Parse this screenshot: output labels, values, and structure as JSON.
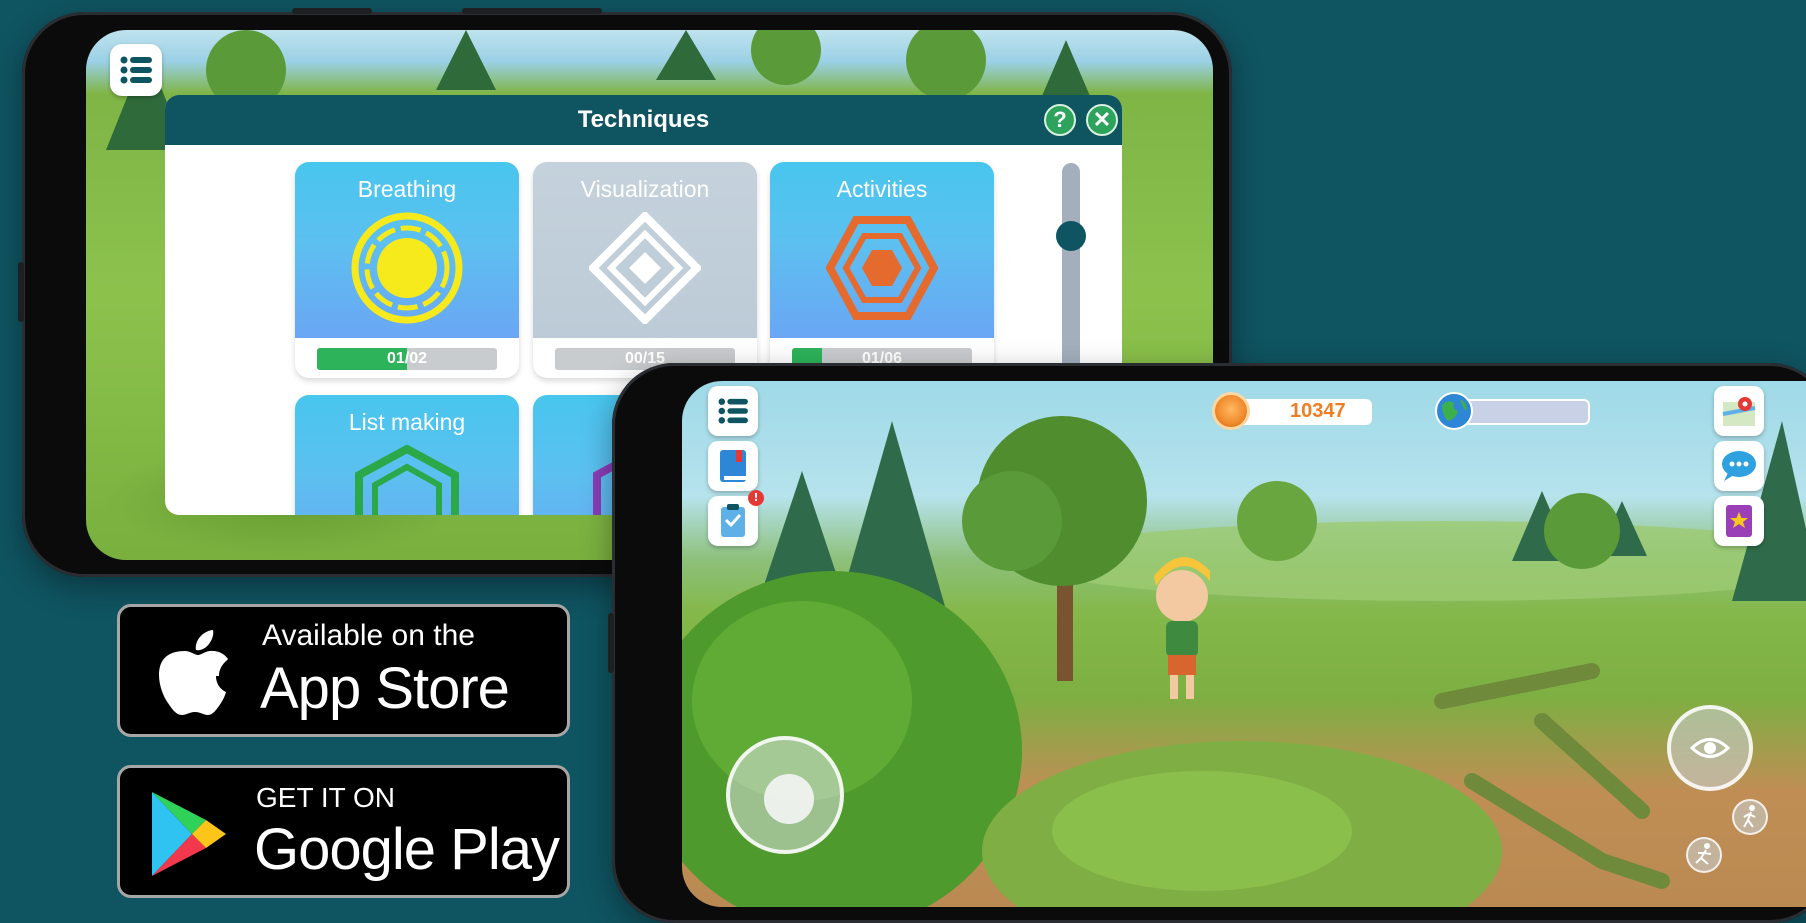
{
  "colors": {
    "background": "#0f5461",
    "modal_header": "#0f5461",
    "progress_fill": "#2db35a",
    "coin_text": "#f07d21",
    "button_green": "#2ea35e"
  },
  "techniques_panel": {
    "title": "Techniques",
    "help_label": "?",
    "close_label": "✕",
    "scroll_position": 0.2,
    "cards": [
      {
        "label": "Breathing",
        "icon": "sun-mandala-icon",
        "progress_text": "01/02",
        "progress": 0.5,
        "locked": false
      },
      {
        "label": "Visualization",
        "icon": "diamond-maze-icon",
        "progress_text": "00/15",
        "progress": 0.0,
        "locked": true
      },
      {
        "label": "Activities",
        "icon": "hexagon-maze-icon",
        "progress_text": "01/06",
        "progress": 0.167,
        "locked": false
      },
      {
        "label": "List making",
        "icon": "green-hexagon-icon",
        "locked": false
      },
      {
        "label": "",
        "icon": "purple-hexagon-icon",
        "locked": false
      }
    ]
  },
  "store_badges": {
    "app_store": {
      "small_text": "Available on the",
      "big_text": "App Store",
      "icon": "apple-icon"
    },
    "google_play": {
      "small_text": "GET IT ON",
      "big_text": "Google Play",
      "icon": "play-triangle-icon"
    }
  },
  "hud": {
    "coins": "10347",
    "world_progress": 0.1,
    "left_icons": [
      "menu-icon",
      "journal-icon",
      "tasks-icon"
    ],
    "tasks_notification": "!",
    "right_icons": [
      "map-icon",
      "chat-icon",
      "album-icon"
    ],
    "action_icons": [
      "eye-icon",
      "walk-icon",
      "run-icon"
    ]
  }
}
